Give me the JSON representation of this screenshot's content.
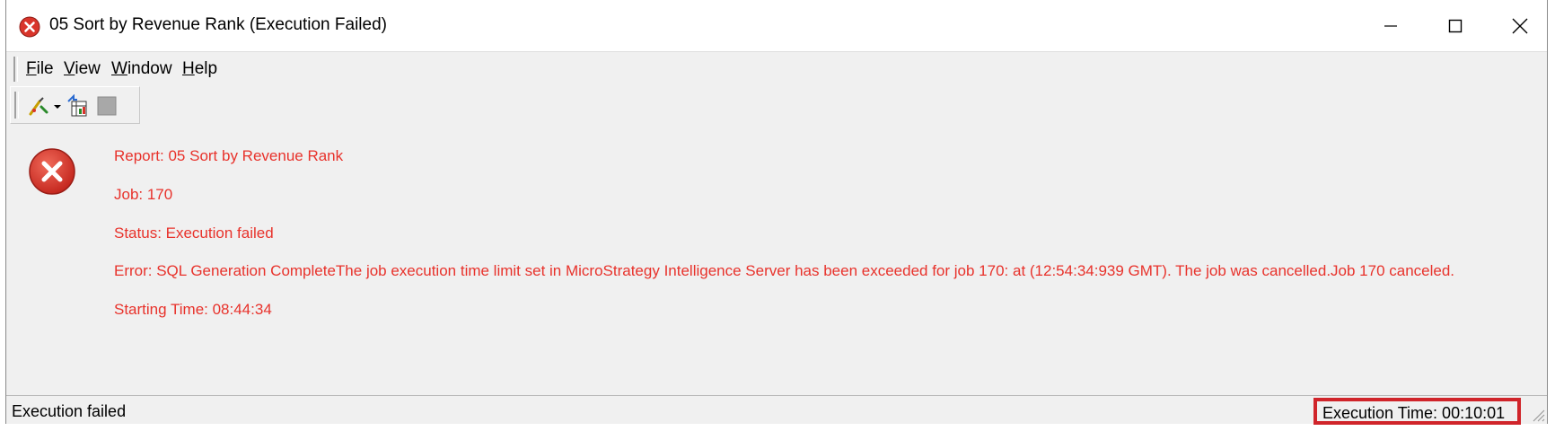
{
  "window": {
    "title": "05 Sort by Revenue Rank (Execution Failed)"
  },
  "menu": {
    "items": [
      {
        "label": "File",
        "mnemonic": "F",
        "rest": "ile"
      },
      {
        "label": "View",
        "mnemonic": "V",
        "rest": "iew"
      },
      {
        "label": "Window",
        "mnemonic": "W",
        "rest": "indow"
      },
      {
        "label": "Help",
        "mnemonic": "H",
        "rest": "elp"
      }
    ]
  },
  "toolbar": {
    "icons": [
      "run-report-icon",
      "dropdown-arrow-icon",
      "export-icon",
      "stop-icon"
    ]
  },
  "details": {
    "report": "Report: 05 Sort by Revenue Rank",
    "job": "Job: 170",
    "status": "Status: Execution failed",
    "error": "Error: SQL Generation CompleteThe job execution time limit set in MicroStrategy Intelligence Server has been exceeded for job 170: at (12:54:34:939 GMT). The job was cancelled.Job 170 canceled.",
    "starting_time": "Starting Time: 08:44:34"
  },
  "statusbar": {
    "left_text": "Execution failed",
    "execution_time": "Execution Time: 00:10:01"
  },
  "colors": {
    "error_text": "#e8322b",
    "highlight_border": "#d0242a",
    "error_icon": "#d9352b"
  }
}
